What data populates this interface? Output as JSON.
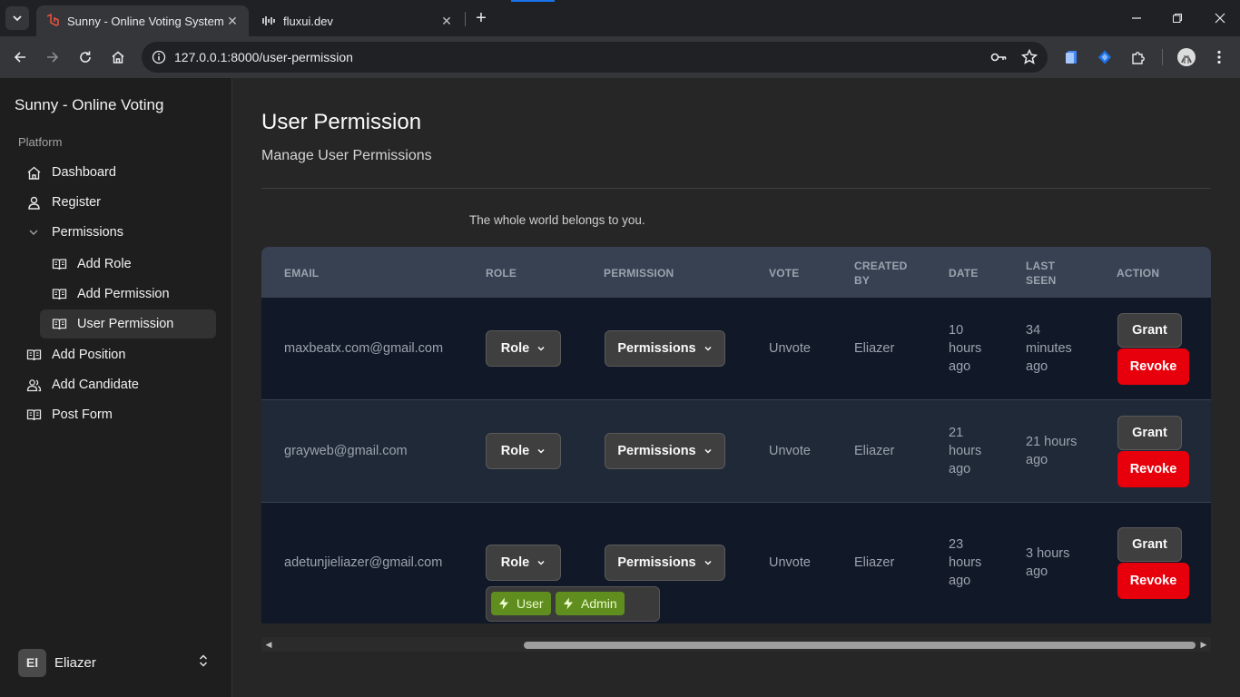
{
  "browser": {
    "tabs": [
      {
        "title": "Sunny - Online Voting System",
        "active": true
      },
      {
        "title": "fluxui.dev",
        "active": false
      }
    ],
    "url": "127.0.0.1:8000/user-permission"
  },
  "sidebar": {
    "brand": "Sunny - Online Voting",
    "group_label": "Platform",
    "items": [
      {
        "label": "Dashboard",
        "icon": "home-icon"
      },
      {
        "label": "Register",
        "icon": "user-icon"
      },
      {
        "label": "Permissions",
        "icon": "chevron-down-icon"
      },
      {
        "label": "Add Role",
        "icon": "book-icon"
      },
      {
        "label": "Add Permission",
        "icon": "book-icon"
      },
      {
        "label": "User Permission",
        "icon": "book-icon"
      },
      {
        "label": "Add Position",
        "icon": "book-icon"
      },
      {
        "label": "Add Candidate",
        "icon": "users-icon"
      },
      {
        "label": "Post Form",
        "icon": "book-icon"
      }
    ],
    "user": {
      "initials": "El",
      "name": "Eliazer"
    }
  },
  "main": {
    "title": "User Permission",
    "subtitle": "Manage User Permissions",
    "tagline": "The whole world belongs to you."
  },
  "table": {
    "headers": {
      "email": "EMAIL",
      "role": "ROLE",
      "permission": "PERMISSION",
      "vote": "VOTE",
      "created_by_1": "CREATED",
      "created_by_2": "BY",
      "date": "DATE",
      "last_seen_1": "LAST",
      "last_seen_2": "SEEN",
      "action": "ACTION"
    },
    "rows": [
      {
        "email": "maxbeatx.com@gmail.com",
        "role_btn": "Role",
        "perm_btn": "Permissions",
        "vote": "Unvote",
        "created_by": "Eliazer",
        "date": [
          "10",
          "hours",
          "ago"
        ],
        "last_seen": [
          "34",
          "minutes",
          "ago"
        ],
        "grant": "Grant",
        "revoke": "Revoke"
      },
      {
        "email": "grayweb@gmail.com",
        "role_btn": "Role",
        "perm_btn": "Permissions",
        "vote": "Unvote",
        "created_by": "Eliazer",
        "date": [
          "21",
          "hours",
          "ago"
        ],
        "last_seen": [
          "21 hours",
          "ago"
        ],
        "grant": "Grant",
        "revoke": "Revoke"
      },
      {
        "email": "adetunjieliazer@gmail.com",
        "role_btn": "Role",
        "perm_btn": "Permissions",
        "vote": "Unvote",
        "created_by": "Eliazer",
        "date": [
          "23",
          "hours",
          "ago"
        ],
        "last_seen": [
          "3 hours",
          "ago"
        ],
        "grant": "Grant",
        "revoke": "Revoke"
      }
    ],
    "permission_tags": [
      "User",
      "Admin"
    ]
  },
  "colors": {
    "header_bg": "#374151",
    "row_dark": "#111827",
    "row_light": "#1f2937",
    "revoke": "#e7000b",
    "tag": "#5f8d1e"
  }
}
